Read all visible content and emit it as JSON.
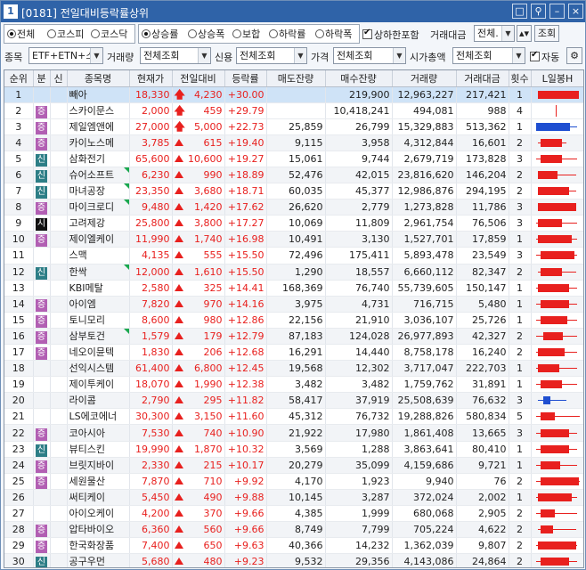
{
  "window": {
    "num": "1",
    "title": "[0181] 전일대비등락률상위",
    "buttons": [
      "□",
      "⚲",
      "–",
      "×"
    ]
  },
  "market": {
    "options": [
      "전체",
      "코스피",
      "코스닥"
    ],
    "selected": 0
  },
  "sort": {
    "options": [
      "상승률",
      "상승폭",
      "보합",
      "하락률",
      "하락폭"
    ],
    "selected": 0
  },
  "limit_check": {
    "label": "상하한포함",
    "checked": true
  },
  "trade_amount": {
    "label": "거래대금",
    "value": "전체.",
    "query": "조회"
  },
  "row2": {
    "item_label": "종목",
    "item_value": "ETF+ETN+스",
    "volume_label": "거래량",
    "volume_value": "전체조회",
    "credit_label": "신용",
    "credit_value": "전체조회",
    "price_label": "가격",
    "price_value": "전체조회",
    "cap_label": "시가총액",
    "cap_value": "전체조회",
    "auto_label": "자동",
    "auto_checked": true
  },
  "columns": [
    "순위",
    "분",
    "신",
    "종목명",
    "현재가",
    "전일대비",
    "등락률",
    "매도잔량",
    "매수잔량",
    "거래량",
    "거래대금",
    "횟수",
    "L일봉H"
  ],
  "rows": [
    {
      "rank": "1",
      "div": "",
      "cr": "",
      "name": "빼아",
      "price": "18,330",
      "chg": "4,230",
      "rate": "+30.00",
      "ask": "",
      "bid": "219,900",
      "vol": "12,963,227",
      "amt": "217,421",
      "cnt": "1",
      "up": "arrow",
      "sel": true,
      "c": [
        0.1,
        0.95,
        0.1,
        0.95
      ]
    },
    {
      "rank": "2",
      "div": "증",
      "cr": "",
      "name": "스카이문스",
      "price": "2,000",
      "chg": "459",
      "rate": "+29.79",
      "ask": "",
      "bid": "10,418,241",
      "vol": "494,081",
      "amt": "988",
      "cnt": "4",
      "up": "arrow",
      "c": [
        0.5,
        0.5,
        0.2,
        0.95
      ],
      "v": true
    },
    {
      "rank": "3",
      "div": "증",
      "cr": "",
      "name": "제일엠앤에",
      "price": "27,000",
      "chg": "5,000",
      "rate": "+22.73",
      "ask": "25,859",
      "bid": "26,799",
      "vol": "15,329,883",
      "amt": "513,362",
      "cnt": "1",
      "up": "arrow",
      "c": [
        0.05,
        0.9,
        0.05,
        0.75
      ],
      "blue": true
    },
    {
      "rank": "4",
      "div": "증",
      "cr": "",
      "name": "카이노스메",
      "price": "3,785",
      "chg": "615",
      "rate": "+19.40",
      "ask": "9,115",
      "bid": "3,958",
      "vol": "4,312,844",
      "amt": "16,601",
      "cnt": "2",
      "up": "tri",
      "alt": true,
      "c": [
        0.1,
        0.7,
        0.15,
        0.6
      ]
    },
    {
      "rank": "5",
      "div": "신",
      "cr": "",
      "name": "삼화전기",
      "price": "65,600",
      "chg": "10,600",
      "rate": "+19.27",
      "ask": "15,061",
      "bid": "9,744",
      "vol": "2,679,719",
      "amt": "173,828",
      "cnt": "3",
      "up": "tri",
      "c": [
        0.05,
        0.9,
        0.15,
        0.6
      ]
    },
    {
      "rank": "6",
      "div": "신",
      "cr": "",
      "name": "슈어소프트",
      "price": "6,230",
      "chg": "990",
      "rate": "+18.89",
      "ask": "52,476",
      "bid": "42,015",
      "vol": "23,816,620",
      "amt": "146,204",
      "cnt": "2",
      "up": "tri",
      "alt": true,
      "flag": true,
      "c": [
        0.1,
        0.9,
        0.1,
        0.5
      ]
    },
    {
      "rank": "7",
      "div": "신",
      "cr": "",
      "name": "마녀공장",
      "price": "23,350",
      "chg": "3,680",
      "rate": "+18.71",
      "ask": "60,035",
      "bid": "45,377",
      "vol": "12,986,876",
      "amt": "294,195",
      "cnt": "2",
      "up": "tri",
      "flag": true,
      "c": [
        0.1,
        0.9,
        0.1,
        0.75
      ]
    },
    {
      "rank": "8",
      "div": "증",
      "cr": "",
      "name": "마이크로디",
      "price": "9,480",
      "chg": "1,420",
      "rate": "+17.62",
      "ask": "26,620",
      "bid": "2,779",
      "vol": "1,273,828",
      "amt": "11,786",
      "cnt": "3",
      "up": "tri",
      "alt": true,
      "flag": true,
      "c": [
        0.1,
        0.9,
        0.1,
        0.9
      ]
    },
    {
      "rank": "9",
      "div": "시",
      "cr": "",
      "name": "고려제강",
      "price": "25,800",
      "chg": "3,800",
      "rate": "+17.27",
      "ask": "10,069",
      "bid": "11,809",
      "vol": "2,961,754",
      "amt": "76,506",
      "cnt": "3",
      "up": "tri",
      "c": [
        0.05,
        0.9,
        0.1,
        0.6
      ],
      "k": true
    },
    {
      "rank": "10",
      "div": "증",
      "cr": "",
      "name": "제이엘케이",
      "price": "11,990",
      "chg": "1,740",
      "rate": "+16.98",
      "ask": "10,491",
      "bid": "3,130",
      "vol": "1,527,701",
      "amt": "17,859",
      "cnt": "1",
      "up": "tri",
      "alt": true,
      "c": [
        0.05,
        0.9,
        0.1,
        0.8
      ]
    },
    {
      "rank": "11",
      "div": "",
      "cr": "",
      "name": "스맥",
      "price": "4,135",
      "chg": "555",
      "rate": "+15.50",
      "ask": "72,496",
      "bid": "175,411",
      "vol": "5,893,478",
      "amt": "23,549",
      "cnt": "3",
      "up": "tri",
      "c": [
        0.05,
        0.9,
        0.15,
        0.85
      ]
    },
    {
      "rank": "12",
      "div": "신",
      "cr": "",
      "name": "한싹",
      "price": "12,000",
      "chg": "1,610",
      "rate": "+15.50",
      "ask": "1,290",
      "bid": "18,557",
      "vol": "6,660,112",
      "amt": "82,347",
      "cnt": "2",
      "up": "tri",
      "alt": true,
      "flag": true,
      "c": [
        0.1,
        0.9,
        0.15,
        0.6
      ]
    },
    {
      "rank": "13",
      "div": "",
      "cr": "",
      "name": "KBI메탈",
      "price": "2,580",
      "chg": "325",
      "rate": "+14.41",
      "ask": "168,369",
      "bid": "76,740",
      "vol": "55,739,605",
      "amt": "150,147",
      "cnt": "1",
      "up": "tri",
      "c": [
        0.05,
        0.9,
        0.1,
        0.75
      ]
    },
    {
      "rank": "14",
      "div": "증",
      "cr": "",
      "name": "아이엠",
      "price": "7,820",
      "chg": "970",
      "rate": "+14.16",
      "ask": "3,975",
      "bid": "4,731",
      "vol": "716,715",
      "amt": "5,480",
      "cnt": "1",
      "up": "tri",
      "alt": true,
      "c": [
        0.05,
        0.9,
        0.15,
        0.75
      ]
    },
    {
      "rank": "15",
      "div": "증",
      "cr": "",
      "name": "토니모리",
      "price": "8,600",
      "chg": "980",
      "rate": "+12.86",
      "ask": "22,156",
      "bid": "21,910",
      "vol": "3,036,107",
      "amt": "25,726",
      "cnt": "1",
      "up": "tri",
      "c": [
        0.05,
        0.9,
        0.15,
        0.7
      ]
    },
    {
      "rank": "16",
      "div": "증",
      "cr": "",
      "name": "삼부토건",
      "price": "1,579",
      "chg": "179",
      "rate": "+12.79",
      "ask": "87,183",
      "bid": "124,028",
      "vol": "26,977,893",
      "amt": "42,327",
      "cnt": "2",
      "up": "tri",
      "alt": true,
      "flag": true,
      "c": [
        0.05,
        0.9,
        0.2,
        0.6
      ]
    },
    {
      "rank": "17",
      "div": "증",
      "cr": "",
      "name": "네오이뮨텍",
      "price": "1,830",
      "chg": "206",
      "rate": "+12.68",
      "ask": "16,291",
      "bid": "14,440",
      "vol": "8,758,178",
      "amt": "16,240",
      "cnt": "2",
      "up": "tri",
      "c": [
        0.05,
        0.9,
        0.1,
        0.65
      ]
    },
    {
      "rank": "18",
      "div": "",
      "cr": "",
      "name": "선익시스템",
      "price": "61,400",
      "chg": "6,800",
      "rate": "+12.45",
      "ask": "19,568",
      "bid": "12,302",
      "vol": "3,717,047",
      "amt": "222,703",
      "cnt": "1",
      "up": "tri",
      "alt": true,
      "c": [
        0.05,
        0.9,
        0.1,
        0.55
      ]
    },
    {
      "rank": "19",
      "div": "",
      "cr": "",
      "name": "제이투케이",
      "price": "18,070",
      "chg": "1,990",
      "rate": "+12.38",
      "ask": "3,482",
      "bid": "3,482",
      "vol": "1,759,762",
      "amt": "31,891",
      "cnt": "1",
      "up": "tri",
      "c": [
        0.05,
        0.9,
        0.15,
        0.6
      ]
    },
    {
      "rank": "20",
      "div": "",
      "cr": "",
      "name": "라이콤",
      "price": "2,790",
      "chg": "295",
      "rate": "+11.82",
      "ask": "58,417",
      "bid": "37,919",
      "vol": "25,508,639",
      "amt": "76,632",
      "cnt": "3",
      "up": "tri",
      "alt": true,
      "c": [
        0.1,
        0.7,
        0.2,
        0.35
      ],
      "blue": true
    },
    {
      "rank": "21",
      "div": "",
      "cr": "",
      "name": "LS에코에너",
      "price": "30,300",
      "chg": "3,150",
      "rate": "+11.60",
      "ask": "45,312",
      "bid": "76,732",
      "vol": "19,288,826",
      "amt": "580,834",
      "cnt": "5",
      "up": "tri",
      "c": [
        0.05,
        0.95,
        0.15,
        0.45
      ]
    },
    {
      "rank": "22",
      "div": "증",
      "cr": "",
      "name": "코아시아",
      "price": "7,530",
      "chg": "740",
      "rate": "+10.90",
      "ask": "21,922",
      "bid": "17,980",
      "vol": "1,861,408",
      "amt": "13,665",
      "cnt": "3",
      "up": "tri",
      "alt": true,
      "c": [
        0.05,
        0.9,
        0.15,
        0.75
      ]
    },
    {
      "rank": "23",
      "div": "신",
      "cr": "",
      "name": "뷰티스킨",
      "price": "19,990",
      "chg": "1,870",
      "rate": "+10.32",
      "ask": "3,569",
      "bid": "1,288",
      "vol": "3,863,641",
      "amt": "80,410",
      "cnt": "1",
      "up": "tri",
      "c": [
        0.05,
        0.9,
        0.15,
        0.75
      ]
    },
    {
      "rank": "24",
      "div": "증",
      "cr": "",
      "name": "브릿지바이",
      "price": "2,330",
      "chg": "215",
      "rate": "+10.17",
      "ask": "20,279",
      "bid": "35,099",
      "vol": "4,159,686",
      "amt": "9,721",
      "cnt": "1",
      "up": "tri",
      "alt": true,
      "c": [
        0.05,
        0.9,
        0.15,
        0.55
      ]
    },
    {
      "rank": "25",
      "div": "증",
      "cr": "",
      "name": "세원물산",
      "price": "7,870",
      "chg": "710",
      "rate": "+9.92",
      "ask": "4,170",
      "bid": "1,923",
      "vol": "9,940",
      "amt": "76",
      "cnt": "2",
      "up": "tri",
      "c": [
        0.05,
        0.95,
        0.15,
        0.95
      ]
    },
    {
      "rank": "26",
      "div": "",
      "cr": "",
      "name": "써티케이",
      "price": "5,450",
      "chg": "490",
      "rate": "+9.88",
      "ask": "10,145",
      "bid": "3,287",
      "vol": "372,024",
      "amt": "2,002",
      "cnt": "1",
      "up": "tri",
      "alt": true,
      "c": [
        0.05,
        0.9,
        0.1,
        0.8
      ]
    },
    {
      "rank": "27",
      "div": "",
      "cr": "",
      "name": "아이오케이",
      "price": "4,200",
      "chg": "370",
      "rate": "+9.66",
      "ask": "4,385",
      "bid": "1,999",
      "vol": "680,068",
      "amt": "2,905",
      "cnt": "2",
      "up": "tri",
      "c": [
        0.05,
        0.9,
        0.15,
        0.45
      ]
    },
    {
      "rank": "28",
      "div": "증",
      "cr": "",
      "name": "압타바이오",
      "price": "6,360",
      "chg": "560",
      "rate": "+9.66",
      "ask": "8,749",
      "bid": "7,799",
      "vol": "705,224",
      "amt": "4,622",
      "cnt": "2",
      "up": "tri",
      "alt": true,
      "c": [
        0.1,
        0.9,
        0.15,
        0.4
      ]
    },
    {
      "rank": "29",
      "div": "증",
      "cr": "",
      "name": "한국화장품",
      "price": "7,400",
      "chg": "650",
      "rate": "+9.63",
      "ask": "40,366",
      "bid": "14,232",
      "vol": "1,362,039",
      "amt": "9,807",
      "cnt": "2",
      "up": "tri",
      "c": [
        0.05,
        0.9,
        0.1,
        0.9
      ]
    },
    {
      "rank": "30",
      "div": "신",
      "cr": "",
      "name": "공구우먼",
      "price": "5,680",
      "chg": "480",
      "rate": "+9.23",
      "ask": "9,532",
      "bid": "29,356",
      "vol": "4,143,086",
      "amt": "24,864",
      "cnt": "2",
      "up": "tri",
      "alt": true,
      "c": [
        0.05,
        0.9,
        0.15,
        0.75
      ]
    }
  ]
}
